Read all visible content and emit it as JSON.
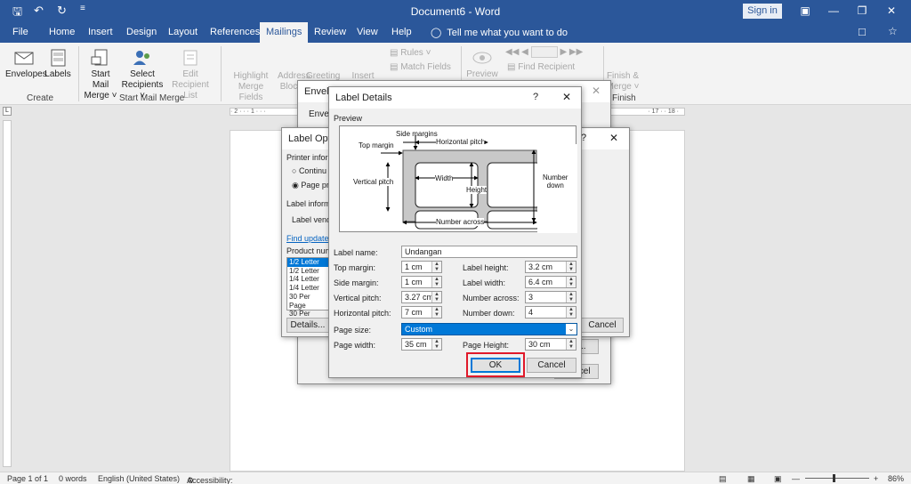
{
  "titlebar": {
    "title": "Document6  -  Word",
    "signin": "Sign in"
  },
  "tabs": [
    "File",
    "Home",
    "Insert",
    "Design",
    "Layout",
    "References",
    "Mailings",
    "Review",
    "View",
    "Help"
  ],
  "active_tab": "Mailings",
  "tellme": "Tell me what you want to do",
  "ribbon": {
    "create": {
      "envelopes": "Envelopes",
      "labels": "Labels",
      "group": "Create"
    },
    "start": {
      "start_mail_merge": "Start Mail",
      "start_mail_merge2": "Merge ˅",
      "select_recipients": "Select",
      "select_recipients2": "Recipients ˅",
      "edit_list": "Edit",
      "edit_list2": "Recipient List",
      "group": "Start Mail Merge"
    },
    "write": {
      "highlight": "Highlight",
      "highlight2": "Merge Fields",
      "address": "Address",
      "address2": "Block",
      "greeting": "Greeting",
      "insert": "Insert Merge",
      "rules": "Rules ˅",
      "match": "Match Fields"
    },
    "preview": {
      "preview": "Preview",
      "find": "Find Recipient"
    },
    "finish": {
      "finish": "Finish &",
      "finish2": "Merge ˅",
      "group": "Finish"
    }
  },
  "ruler_text": "· 2 · · · 1 · · ·",
  "ruler_text_right": "· 17 · · 18 ·",
  "status": {
    "page": "Page 1 of 1",
    "words": "0 words",
    "language": "English (United States)",
    "accessibility": "Accessibility: Good to go",
    "zoom": "86%"
  },
  "envelopes_dialog": {
    "title": "Envelo",
    "tab": "Envel"
  },
  "label_options": {
    "title": "Label Optio",
    "printer_info": "Printer inform",
    "continuous": "Continu",
    "page_printers": "Page pr",
    "label_info": "Label inform",
    "label_vendor": "Label vend",
    "find_updates": "Find update",
    "product_number": "Product num",
    "products": [
      "1/2 Letter",
      "1/2 Letter",
      "1/4 Letter",
      "1/4 Letter",
      "30 Per Page",
      "30 Per Page"
    ],
    "details": "Details...",
    "cancel": "Cancel",
    "t7": "?"
  },
  "underlying": {
    "cancel2": "Cancel",
    "ies": "ies..."
  },
  "label_details": {
    "title": "Label Details",
    "help": "?",
    "close": "✕",
    "preview_label": "Preview",
    "preview": {
      "side_margins": "Side margins",
      "top_margin": "Top margin",
      "horizontal_pitch": "Horizontal pitch",
      "vertical_pitch": "Vertical pitch",
      "width": "Width",
      "height": "Height",
      "number_down": "Number",
      "number_down2": "down",
      "number_across": "Number across"
    },
    "fields": {
      "label_name": {
        "label": "Label name:",
        "value": "Undangan"
      },
      "top_margin": {
        "label": "Top margin:",
        "value": "1 cm"
      },
      "side_margin": {
        "label": "Side margin:",
        "value": "1 cm"
      },
      "vertical_pitch": {
        "label": "Vertical pitch:",
        "value": "3.27 cm"
      },
      "horizontal_pitch": {
        "label": "Horizontal pitch:",
        "value": "7 cm"
      },
      "label_height": {
        "label": "Label height:",
        "value": "3.2 cm"
      },
      "label_width": {
        "label": "Label width:",
        "value": "6.4 cm"
      },
      "number_across": {
        "label": "Number across:",
        "value": "3"
      },
      "number_down": {
        "label": "Number down:",
        "value": "4"
      },
      "page_size": {
        "label": "Page size:",
        "value": "Custom"
      },
      "page_width": {
        "label": "Page width:",
        "value": "35 cm"
      },
      "page_height": {
        "label": "Page Height:",
        "value": "30 cm"
      }
    },
    "ok": "OK",
    "cancel": "Cancel"
  },
  "colors": {
    "word_blue": "#2b579a",
    "highlight_red": "#e0192a",
    "select_blue": "#0078d7"
  }
}
